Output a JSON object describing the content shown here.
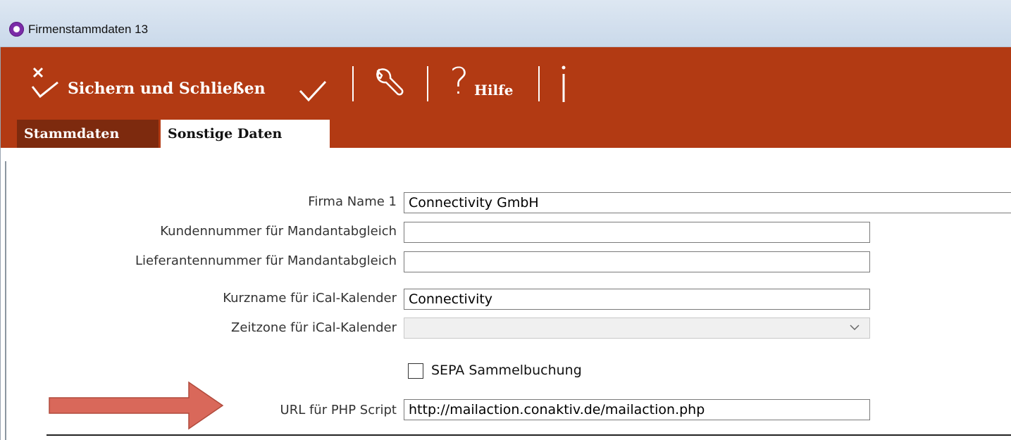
{
  "window": {
    "title": "Firmenstammdaten 13"
  },
  "toolbar": {
    "save_close_label": "Sichern und Schließen",
    "help_label": "Hilfe",
    "help_glyph": "?",
    "icons": [
      "close-check-icon",
      "check-icon",
      "wrench-icon",
      "help-icon",
      "info-icon"
    ]
  },
  "tabs": [
    {
      "label": "Stammdaten",
      "active": false
    },
    {
      "label": "Sonstige Daten",
      "active": true
    }
  ],
  "form": {
    "firma_name_1": {
      "label": "Firma Name 1",
      "value": "Connectivity GmbH"
    },
    "kundennummer": {
      "label": "Kundennummer für Mandantabgleich",
      "value": ""
    },
    "lieferantennummer": {
      "label": "Lieferantennummer für Mandantabgleich",
      "value": ""
    },
    "kurzname_ical": {
      "label": "Kurzname für iCal-Kalender",
      "value": "Connectivity"
    },
    "zeitzone_ical": {
      "label": "Zeitzone für iCal-Kalender",
      "value": ""
    },
    "sepa": {
      "label": "SEPA Sammelbuchung",
      "checked": false
    },
    "url_php": {
      "label": "URL für PHP Script",
      "value": "http://mailaction.conaktiv.de/mailaction.php"
    }
  },
  "colors": {
    "ribbon": "#b23a13",
    "tab_inactive": "#7d2a0e",
    "arrow": "#d9685a"
  }
}
